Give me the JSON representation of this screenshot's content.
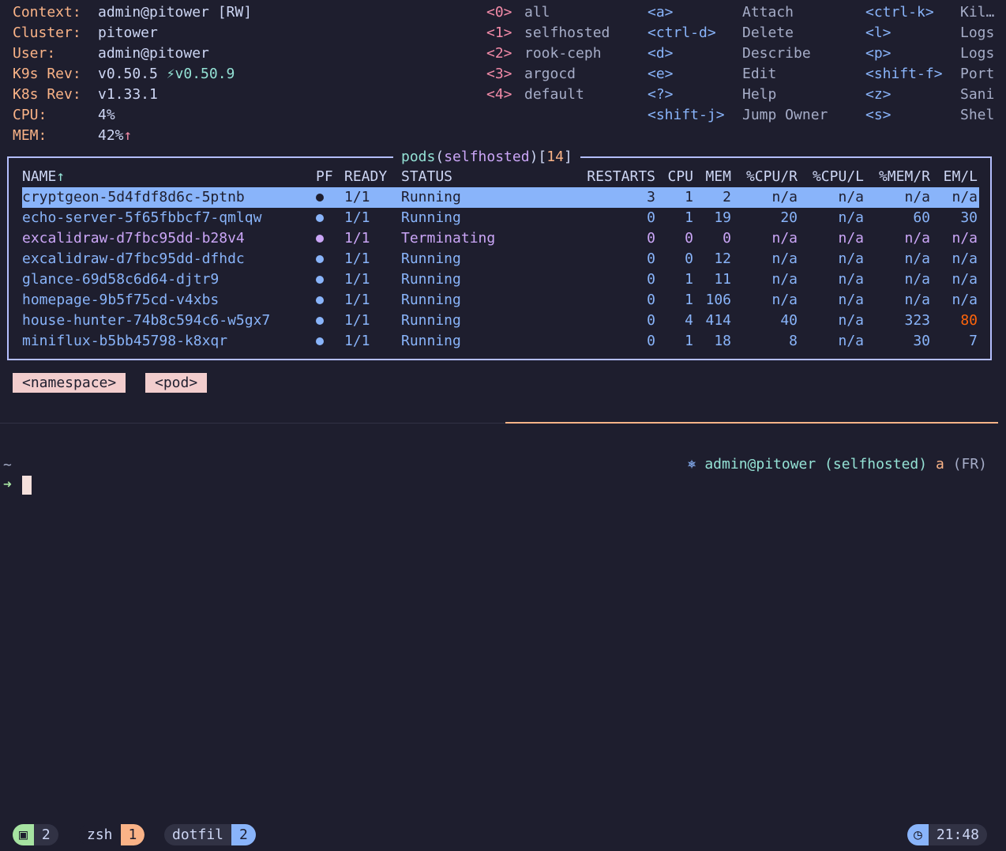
{
  "header": {
    "info": [
      {
        "label": "Context:",
        "value": "admin@pitower [RW]"
      },
      {
        "label": "Cluster:",
        "value": "pitower"
      },
      {
        "label": "User:",
        "value": "admin@pitower"
      },
      {
        "label": "K9s Rev:",
        "value": "v0.50.5",
        "update": "⚡v0.50.9"
      },
      {
        "label": "K8s Rev:",
        "value": "v1.33.1"
      },
      {
        "label": "CPU:",
        "value": "4%"
      },
      {
        "label": "MEM:",
        "value": "42%",
        "trend": "↑"
      }
    ],
    "namespaces": [
      {
        "key": "<0>",
        "name": "all"
      },
      {
        "key": "<1>",
        "name": "selfhosted"
      },
      {
        "key": "<2>",
        "name": "rook-ceph"
      },
      {
        "key": "<3>",
        "name": "argocd"
      },
      {
        "key": "<4>",
        "name": "default"
      }
    ],
    "shortcuts_a": [
      {
        "key": "<a>",
        "action": "Attach"
      },
      {
        "key": "<ctrl-d>",
        "action": "Delete"
      },
      {
        "key": "<d>",
        "action": "Describe"
      },
      {
        "key": "<e>",
        "action": "Edit"
      },
      {
        "key": "<?>",
        "action": "Help"
      },
      {
        "key": "<shift-j>",
        "action": "Jump Owner"
      }
    ],
    "shortcuts_b": [
      {
        "key": "<ctrl-k>",
        "action": "Kil…"
      },
      {
        "key": "<l>",
        "action": "Logs"
      },
      {
        "key": "<p>",
        "action": "Logs"
      },
      {
        "key": "<shift-f>",
        "action": "Port"
      },
      {
        "key": "<z>",
        "action": "Sani"
      },
      {
        "key": "<s>",
        "action": "Shel"
      }
    ]
  },
  "table": {
    "title_resource": "pods",
    "title_namespace": "selfhosted",
    "title_count": "14",
    "columns": {
      "name": "NAME",
      "name_sort": "↑",
      "pf": "PF",
      "ready": "READY",
      "status": "STATUS",
      "restarts": "RESTARTS",
      "cpu": "CPU",
      "mem": "MEM",
      "cpu_r": "%CPU/R",
      "cpu_l": "%CPU/L",
      "mem_r": "%MEM/R",
      "mem_l": "EM/L"
    },
    "rows": [
      {
        "name": "cryptgeon-5d4fdf8d6c-5ptnb",
        "pf_color": "#1e1e2e",
        "ready": "1/1",
        "status": "Running",
        "restarts": "3",
        "cpu": "1",
        "mem": "2",
        "cpu_r": "n/a",
        "cpu_l": "n/a",
        "mem_r": "n/a",
        "mem_l": "n/a",
        "selected": true
      },
      {
        "name": "echo-server-5f65fbbcf7-qmlqw",
        "pf_color": "#89b4fa",
        "ready": "1/1",
        "status": "Running",
        "restarts": "0",
        "cpu": "1",
        "mem": "19",
        "cpu_r": "20",
        "cpu_l": "n/a",
        "mem_r": "60",
        "mem_l": "30"
      },
      {
        "name": "excalidraw-d7fbc95dd-b28v4",
        "pf_color": "#cba6f7",
        "ready": "1/1",
        "status": "Terminating",
        "restarts": "0",
        "cpu": "0",
        "mem": "0",
        "cpu_r": "n/a",
        "cpu_l": "n/a",
        "mem_r": "n/a",
        "mem_l": "n/a",
        "terminating": true
      },
      {
        "name": "excalidraw-d7fbc95dd-dfhdc",
        "pf_color": "#89b4fa",
        "ready": "1/1",
        "status": "Running",
        "restarts": "0",
        "cpu": "0",
        "mem": "12",
        "cpu_r": "n/a",
        "cpu_l": "n/a",
        "mem_r": "n/a",
        "mem_l": "n/a"
      },
      {
        "name": "glance-69d58c6d64-djtr9",
        "pf_color": "#89b4fa",
        "ready": "1/1",
        "status": "Running",
        "restarts": "0",
        "cpu": "1",
        "mem": "11",
        "cpu_r": "n/a",
        "cpu_l": "n/a",
        "mem_r": "n/a",
        "mem_l": "n/a"
      },
      {
        "name": "homepage-9b5f75cd-v4xbs",
        "pf_color": "#89b4fa",
        "ready": "1/1",
        "status": "Running",
        "restarts": "0",
        "cpu": "1",
        "mem": "106",
        "cpu_r": "n/a",
        "cpu_l": "n/a",
        "mem_r": "n/a",
        "mem_l": "n/a"
      },
      {
        "name": "house-hunter-74b8c594c6-w5gx7",
        "pf_color": "#89b4fa",
        "ready": "1/1",
        "status": "Running",
        "restarts": "0",
        "cpu": "4",
        "mem": "414",
        "cpu_r": "40",
        "cpu_l": "n/a",
        "mem_r": "323",
        "mem_l": "80",
        "mem_l_warn": true
      },
      {
        "name": "miniflux-b5bb45798-k8xqr",
        "pf_color": "#89b4fa",
        "ready": "1/1",
        "status": "Running",
        "restarts": "0",
        "cpu": "1",
        "mem": "18",
        "cpu_r": "8",
        "cpu_l": "n/a",
        "mem_r": "30",
        "mem_l": "7"
      }
    ]
  },
  "crumbs": [
    "<namespace>",
    "<pod>"
  ],
  "shell": {
    "cwd": "~",
    "prompt": "➜",
    "k8s_icon": "⎈",
    "k8s_context": "admin@pitower (selfhosted)",
    "aws_icon": "a",
    "aws_region": "(FR)"
  },
  "statusbar": {
    "windows": [
      {
        "index": "2"
      },
      {
        "name": "zsh",
        "index": "1"
      },
      {
        "name": "dotfil",
        "index": "2"
      }
    ],
    "time": "21:48"
  },
  "colors": {
    "background": "#1e1e2e",
    "accent": "#89b4fa",
    "label": "#fab387",
    "warning": "#fe640b"
  }
}
